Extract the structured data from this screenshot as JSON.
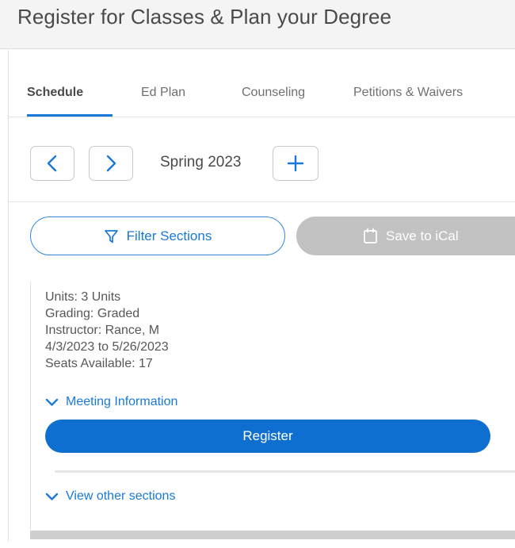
{
  "header": {
    "title": "Register for Classes & Plan your Degree"
  },
  "tabs": [
    {
      "label": "Schedule",
      "active": true
    },
    {
      "label": "Ed Plan",
      "active": false
    },
    {
      "label": "Counseling",
      "active": false
    },
    {
      "label": "Petitions & Waivers",
      "active": false
    }
  ],
  "term_nav": {
    "prev_icon": "chevron-left-icon",
    "next_icon": "chevron-right-icon",
    "term_label": "Spring 2023",
    "add_icon": "plus-icon"
  },
  "actions": {
    "filter": {
      "label": "Filter Sections",
      "icon": "funnel-icon",
      "color": "#1879d9"
    },
    "ical": {
      "label": "Save to iCal",
      "icon": "calendar-icon",
      "disabled": true,
      "color": "#c2c2c2"
    }
  },
  "section_card": {
    "details": [
      "Units: 3 Units",
      "Grading: Graded",
      "Instructor: Rance, M",
      "4/3/2023 to 5/26/2023",
      "Seats Available:  17"
    ],
    "meeting_information": {
      "label": "Meeting Information",
      "icon": "chevron-down-icon"
    },
    "register": {
      "label": "Register",
      "color": "#0f6fd1"
    },
    "view_other_sections": {
      "label": "View other sections",
      "icon": "chevron-down-icon"
    }
  },
  "colors": {
    "accent_blue": "#1879d9",
    "register_blue": "#0f6fd1",
    "disabled_grey": "#c2c2c2",
    "header_bg": "#f4f4f4",
    "text_grey": "#575757"
  }
}
